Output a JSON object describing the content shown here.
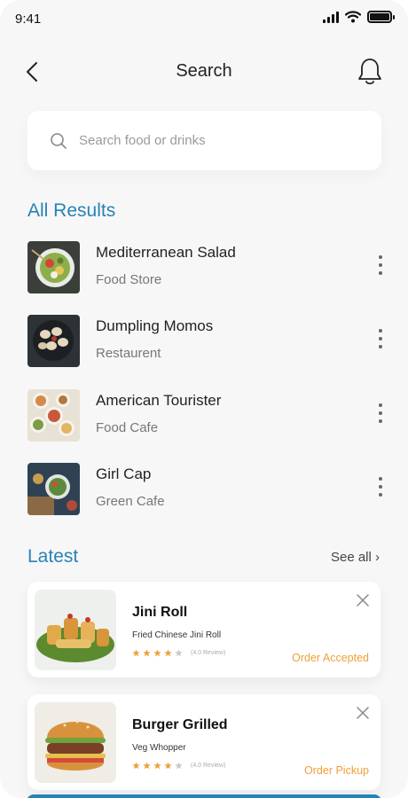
{
  "status_bar": {
    "time": "9:41"
  },
  "header": {
    "title": "Search"
  },
  "search": {
    "placeholder": "Search food or drinks",
    "value": ""
  },
  "sections": {
    "all_results": "All Results",
    "latest": "Latest",
    "see_all": "See all ›"
  },
  "results": [
    {
      "name": "Mediterranean Salad",
      "category": "Food Store"
    },
    {
      "name": "Dumpling Momos",
      "category": "Restaurent"
    },
    {
      "name": "American Tourister",
      "category": "Food Cafe"
    },
    {
      "name": "Girl Cap",
      "category": "Green Cafe"
    }
  ],
  "latest": [
    {
      "title": "Jini Roll",
      "subtitle": "Fried Chinese Jini Roll",
      "rating": 4,
      "review": "(4.0 Review)",
      "status": "Order Accepted"
    },
    {
      "title": "Burger Grilled",
      "subtitle": "Veg Whopper",
      "rating": 4,
      "review": "(4.0 Review)",
      "status": "Order Pickup"
    }
  ],
  "colors": {
    "accent": "#2683b8",
    "status": "#f0a038",
    "star": "#f0a038",
    "star_empty": "#c8c8c8"
  },
  "icons": [
    "back-arrow-icon",
    "bell-icon",
    "search-icon",
    "more-vertical-icon",
    "close-icon",
    "star-icon"
  ]
}
